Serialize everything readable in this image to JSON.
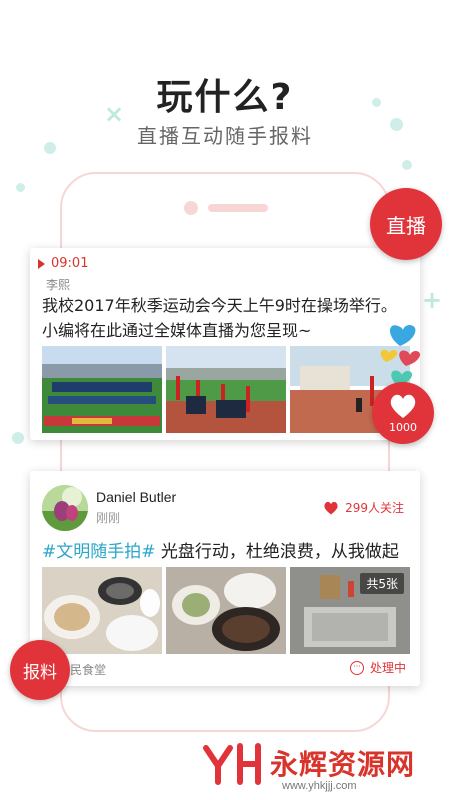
{
  "hero": {
    "title": "玩什么?",
    "subtitle": "直播互动随手报料"
  },
  "live_button": {
    "label": "直播"
  },
  "live_post": {
    "time": "09:01",
    "author": "李熙",
    "text": "我校2017年秋季运动会今天上午9时在操场举行。小编将在此通过全媒体直播为您呈现~",
    "like_count": "1000"
  },
  "post": {
    "username": "Daniel Butler",
    "time": "刚刚",
    "followers": "299人关注",
    "tag": "#文明随手拍#",
    "text": " 光盘行动，杜绝浪费，从我做起",
    "photo_count": "共5张",
    "location": "民食堂",
    "status": "处理中"
  },
  "report_button": {
    "label": "报料"
  },
  "brand": {
    "name": "永辉资源网",
    "url": "www.yhkjjj.com"
  },
  "colors": {
    "accent": "#e0343a",
    "tag": "#2aa6c8"
  }
}
